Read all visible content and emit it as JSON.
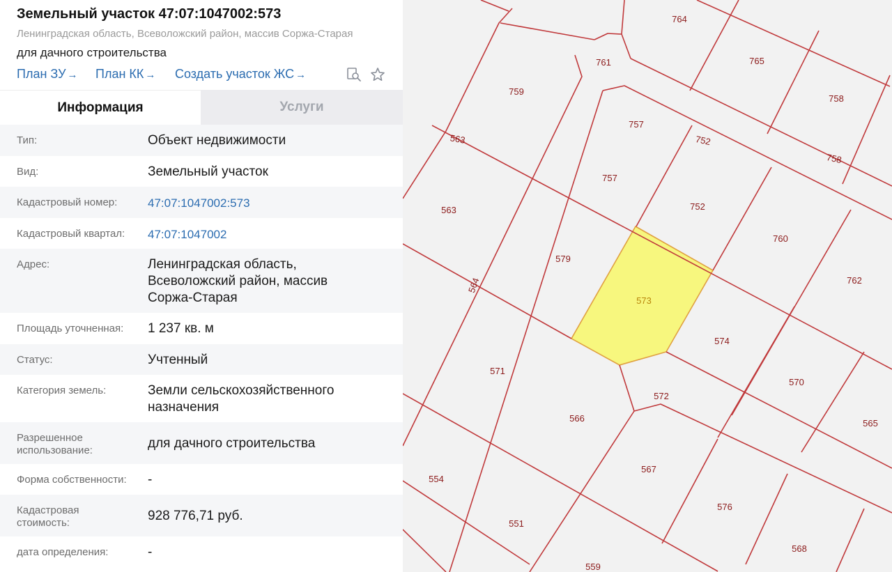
{
  "header": {
    "title": "Земельный участок 47:07:1047002:573",
    "subtitle": "Ленинградская область, Всеволожский район, массив Соржа-Старая",
    "usage": "для дачного строительства",
    "links": [
      {
        "label": "План ЗУ",
        "arrow": "→"
      },
      {
        "label": "План КК",
        "arrow": "→"
      },
      {
        "label": "Создать участок ЖС",
        "arrow": "→"
      }
    ],
    "icons": [
      "search-document-icon",
      "star-icon"
    ]
  },
  "tabs": [
    {
      "label": "Информация",
      "active": true
    },
    {
      "label": "Услуги",
      "active": false
    }
  ],
  "info": {
    "type_label": "Тип:",
    "type_value": "Объект недвижимости",
    "kind_label": "Вид:",
    "kind_value": "Земельный участок",
    "cad_num_label": "Кадастровый номер:",
    "cad_num_value": "47:07:1047002:573",
    "cad_block_label": "Кадастровый квартал:",
    "cad_block_value": "47:07:1047002",
    "address_label": "Адрес:",
    "address_value": "Ленинградская область,\nВсеволожский район, массив\nСоржа-Старая",
    "area_label": "Площадь уточненная:",
    "area_value": "1 237 кв. м",
    "status_label": "Статус:",
    "status_value": "Учтенный",
    "category_label": "Категория земель:",
    "category_value": "Земли сельскохозяйственного\nназначения",
    "permitted_label": "Разрешенное\nиспользование:",
    "permitted_value": "для дачного строительства",
    "ownership_label": "Форма собственности:",
    "ownership_value": "-",
    "cost_label": "Кадастровая\nстоимость:",
    "cost_value": "928 776,71 руб.",
    "date_label": "дата определения:",
    "date_value": "-"
  },
  "map": {
    "selected_parcel": "573",
    "parcel_labels": [
      "764",
      "761",
      "765",
      "759",
      "758",
      "757",
      "752",
      "758",
      "563",
      "757",
      "752",
      "563",
      "760",
      "579",
      "564",
      "573",
      "762",
      "574",
      "571",
      "570",
      "572",
      "566",
      "565",
      "567",
      "554",
      "576",
      "551",
      "568",
      "559"
    ],
    "colors": {
      "boundary": "#c0393b",
      "selected_fill": "#f7f77e",
      "selected_stroke": "#e0a040",
      "background": "#f2f2f2",
      "label": "#8b1a1a"
    }
  }
}
